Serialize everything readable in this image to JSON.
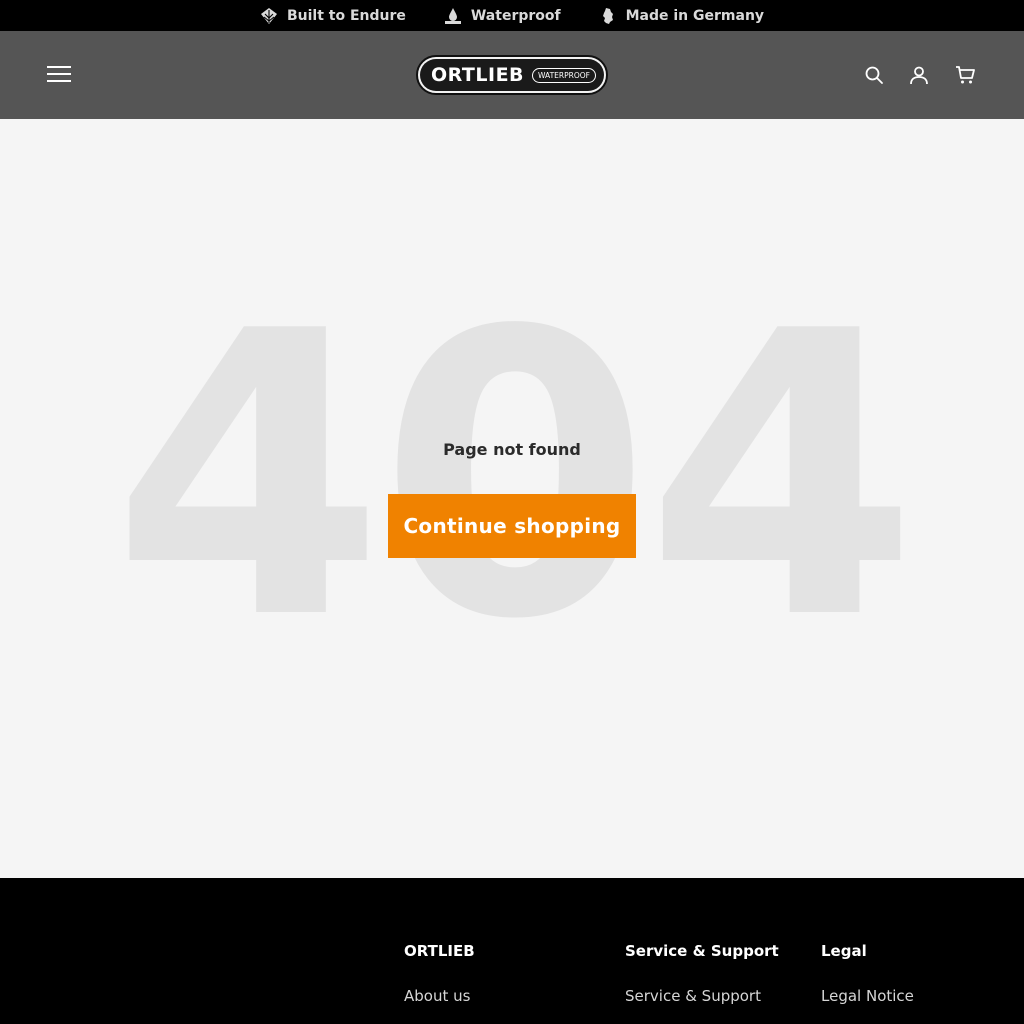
{
  "topbar": {
    "items": [
      {
        "label": "Built to Endure",
        "icon": "leaf-icon"
      },
      {
        "label": "Waterproof",
        "icon": "water-drop-icon"
      },
      {
        "label": "Made in Germany",
        "icon": "germany-map-icon"
      }
    ]
  },
  "header": {
    "logo_word": "ORTLIEB",
    "logo_badge": "WATERPROOF",
    "icons": [
      "menu-icon",
      "search-icon",
      "account-icon",
      "cart-icon"
    ]
  },
  "main": {
    "big_number": "404",
    "message": "Page not found",
    "cta_label": "Continue shopping"
  },
  "footer": {
    "columns": [
      {
        "title": "ORTLIEB",
        "links": [
          "About us"
        ]
      },
      {
        "title": "Service & Support",
        "links": [
          "Service & Support"
        ]
      },
      {
        "title": "Legal",
        "links": [
          "Legal Notice"
        ]
      }
    ]
  },
  "colors": {
    "accent": "#f08200",
    "header_bg": "#555555",
    "topbar_bg": "#000000",
    "page_bg": "#f5f5f5",
    "watermark": "#e3e3e3"
  }
}
